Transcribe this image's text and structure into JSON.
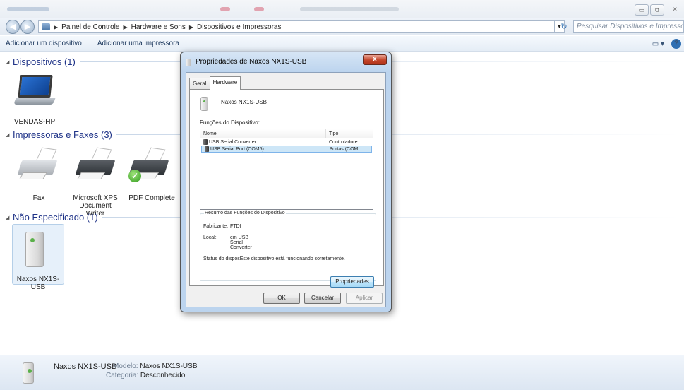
{
  "window": {
    "controls": {
      "minimize": "▭",
      "maximize": "⧉",
      "close": "✕"
    }
  },
  "address": {
    "back": "◀",
    "forward": "▶",
    "crumbs": [
      "Painel de Controle",
      "Hardware e Sons",
      "Dispositivos e Impressoras"
    ],
    "search_placeholder": "Pesquisar Dispositivos e Impressoras"
  },
  "command_bar": {
    "add_device": "Adicionar um dispositivo",
    "add_printer": "Adicionar uma impressora",
    "view_icon": "view-options-icon",
    "help": "?"
  },
  "groups": {
    "devices": {
      "title": "Dispositivos (1)",
      "items": [
        {
          "label": "VENDAS-HP",
          "icon": "laptop-icon"
        }
      ]
    },
    "printers": {
      "title": "Impressoras e Faxes (3)",
      "items": [
        {
          "label": "Fax",
          "icon": "fax-icon"
        },
        {
          "label": "Microsoft XPS Document Writer",
          "icon": "printer-icon"
        },
        {
          "label": "PDF Complete",
          "icon": "printer-icon",
          "default": true
        }
      ]
    },
    "unspecified": {
      "title": "Não Especificado (1)",
      "items": [
        {
          "label": "Naxos NX1S-USB",
          "icon": "tower-icon"
        }
      ]
    }
  },
  "details": {
    "name": "Naxos NX1S-USB",
    "model_key": "Modelo:",
    "model_value": "Naxos NX1S-USB",
    "category_key": "Categoria:",
    "category_value": "Desconhecido"
  },
  "dialog": {
    "title": "Propriedades de Naxos NX1S-USB",
    "close": "X",
    "tabs": [
      "Geral",
      "Hardware"
    ],
    "active_tab": "Hardware",
    "device_name": "Naxos NX1S-USB",
    "functions_label": "Funções do Dispositivo:",
    "columns": [
      "Nome",
      "Tipo"
    ],
    "rows": [
      {
        "name": "USB Serial Converter",
        "type": "Controladore..."
      },
      {
        "name": "USB Serial Port (COM5)",
        "type": "Portas (COM..."
      }
    ],
    "selected_row": 1,
    "summary_title": "Resumo das Funções do Dispositivo",
    "manufacturer_key": "Fabricante:",
    "manufacturer_value": "FTDI",
    "location_key": "Local:",
    "location_value": "em USB Serial Converter",
    "status_text": "Status do disposEste dispositivo está funcionando corretamente.",
    "properties_button": "Propriedades",
    "ok": "OK",
    "cancel": "Cancelar",
    "apply": "Aplicar"
  },
  "colors": {
    "accent": "#1e3287",
    "selection": "#cde6f7",
    "close_button": "#c4452a"
  }
}
